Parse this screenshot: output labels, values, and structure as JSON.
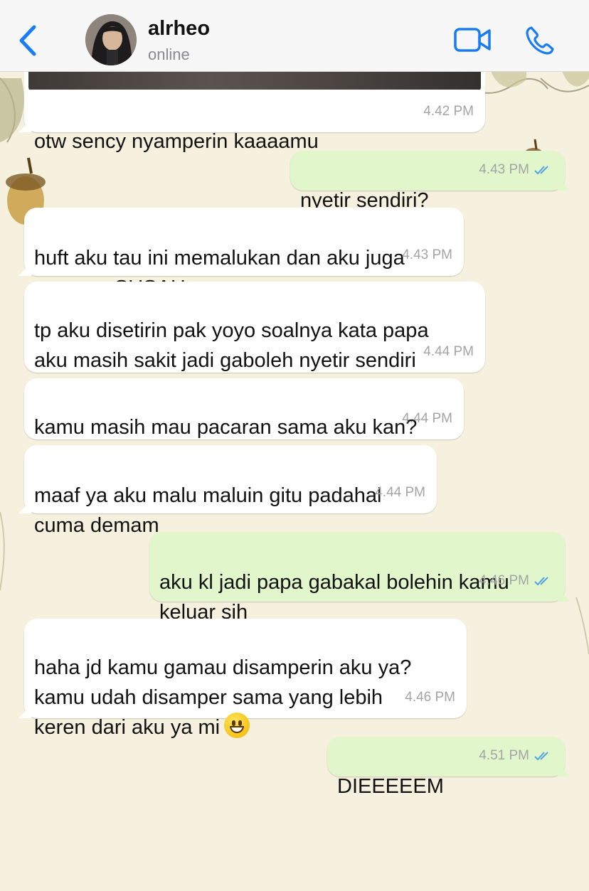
{
  "header": {
    "contact_name": "alrheo",
    "status": "online",
    "icons": [
      "chevron-left-icon",
      "avatar",
      "video-call-icon",
      "phone-icon"
    ],
    "accent_color": "#1a7cf5"
  },
  "messages": [
    {
      "id": "m0",
      "direction": "in",
      "text": "otw sency nyamperin kaaaamu",
      "time": "4.42 PM"
    },
    {
      "id": "m1",
      "direction": "out",
      "text": "nyetir sendiri?",
      "time": "4.43 PM",
      "read": true
    },
    {
      "id": "m2",
      "direction": "in",
      "text": "huft aku tau ini memalukan dan aku juga\nngerasa SUSAH ngomongnya",
      "time": "4.43 PM"
    },
    {
      "id": "m3",
      "direction": "in",
      "text": "tp aku disetirin pak yoyo soalnya kata papa\naku masih sakit jadi gaboleh nyetir sendiri",
      "time": "4.44 PM"
    },
    {
      "id": "m4",
      "direction": "in",
      "text": "kamu masih mau pacaran sama aku kan?",
      "time": "4.44 PM"
    },
    {
      "id": "m5",
      "direction": "in",
      "text": "maaf ya aku malu maluin gitu padahal\ncuma demam",
      "time": "4.44 PM"
    },
    {
      "id": "m6",
      "direction": "out",
      "text": "aku kl jadi papa gabakal bolehin kamu\nkeluar sih",
      "time": "4.46 PM",
      "read": true
    },
    {
      "id": "m7",
      "direction": "in",
      "text": "haha jd kamu gamau disamperin aku ya?\nkamu udah disamper sama yang lebih\nkeren dari aku ya mi",
      "emoji": "grinning-face-emoji",
      "time": "4.46 PM"
    },
    {
      "id": "m8",
      "direction": "out",
      "text": "DIEEEEEM",
      "time": "4.51 PM",
      "read": true
    }
  ],
  "colors": {
    "incoming_bubble": "#ffffff",
    "outgoing_bubble": "#e1f7cb",
    "read_ticks": "#4fa3e8",
    "wallpaper": "#f6f1de"
  }
}
